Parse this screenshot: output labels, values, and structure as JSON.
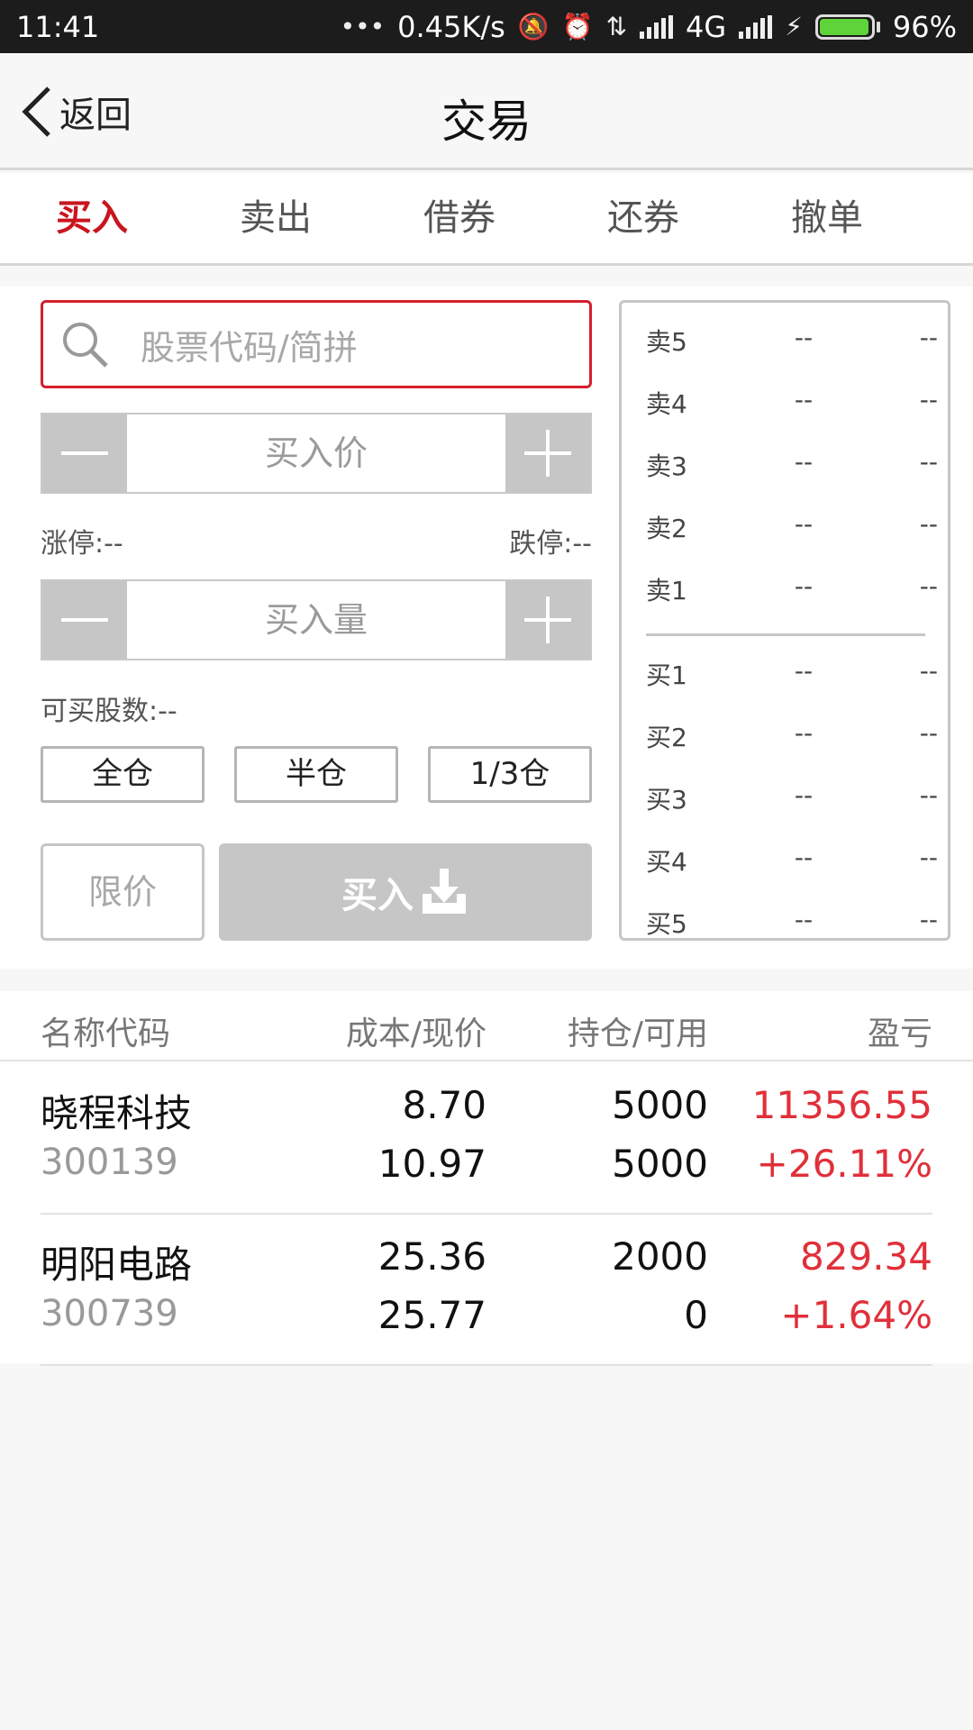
{
  "status_bar": {
    "time": "11:41",
    "net_speed": "0.45K/s",
    "network": "4G",
    "battery": "96%",
    "battery_level": 0.96
  },
  "nav": {
    "back_label": "返回",
    "title": "交易"
  },
  "tabs": [
    {
      "label": "买入"
    },
    {
      "label": "卖出"
    },
    {
      "label": "借券"
    },
    {
      "label": "还券"
    },
    {
      "label": "撤单"
    }
  ],
  "form": {
    "search_placeholder": "股票代码/简拼",
    "price_placeholder": "买入价",
    "limit_up": "涨停:--",
    "limit_down": "跌停:--",
    "qty_placeholder": "买入量",
    "can_buy": "可买股数:--",
    "ratios": [
      "全仓",
      "半仓",
      "1/3仓"
    ],
    "order_type": "限价",
    "submit_label": "买入"
  },
  "order_book": {
    "asks": [
      {
        "level": "卖5",
        "price": "--",
        "volume": "--"
      },
      {
        "level": "卖4",
        "price": "--",
        "volume": "--"
      },
      {
        "level": "卖3",
        "price": "--",
        "volume": "--"
      },
      {
        "level": "卖2",
        "price": "--",
        "volume": "--"
      },
      {
        "level": "卖1",
        "price": "--",
        "volume": "--"
      }
    ],
    "bids": [
      {
        "level": "买1",
        "price": "--",
        "volume": "--"
      },
      {
        "level": "买2",
        "price": "--",
        "volume": "--"
      },
      {
        "level": "买3",
        "price": "--",
        "volume": "--"
      },
      {
        "level": "买4",
        "price": "--",
        "volume": "--"
      },
      {
        "level": "买5",
        "price": "--",
        "volume": "--"
      }
    ]
  },
  "positions": {
    "headers": [
      "名称代码",
      "成本/现价",
      "持仓/可用",
      "盈亏"
    ],
    "rows": [
      {
        "name": "晓程科技",
        "code": "300139",
        "cost": "8.70",
        "price": "10.97",
        "holding": "5000",
        "available": "5000",
        "pl": "11356.55",
        "pl_pct": "+26.11%"
      },
      {
        "name": "明阳电路",
        "code": "300739",
        "cost": "25.36",
        "price": "25.77",
        "holding": "2000",
        "available": "0",
        "pl": "829.34",
        "pl_pct": "+1.64%"
      }
    ]
  },
  "colors": {
    "accent": "#c9151e",
    "profit": "#e0303a",
    "disabled": "#c6c6c6"
  }
}
